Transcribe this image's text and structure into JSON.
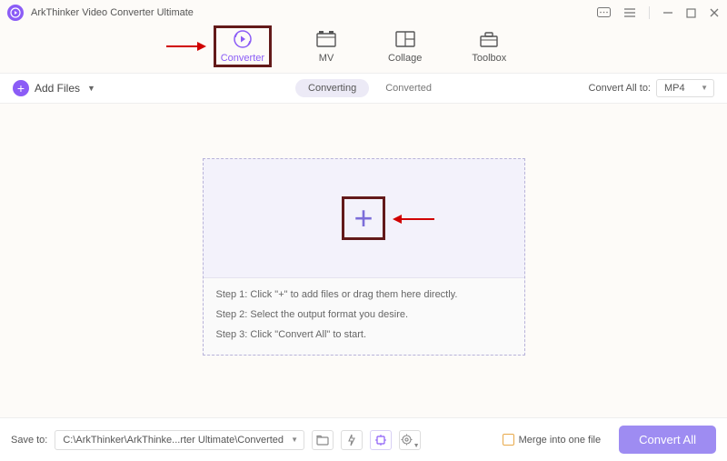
{
  "titlebar": {
    "title": "ArkThinker Video Converter Ultimate"
  },
  "tabs": {
    "converter": "Converter",
    "mv": "MV",
    "collage": "Collage",
    "toolbox": "Toolbox"
  },
  "toolbar": {
    "add_files": "Add Files",
    "converting": "Converting",
    "converted": "Converted",
    "convert_all_to": "Convert All to:",
    "format": "MP4"
  },
  "dropzone": {
    "step1": "Step 1: Click \"+\" to add files or drag them here directly.",
    "step2": "Step 2: Select the output format you desire.",
    "step3": "Step 3: Click \"Convert All\" to start."
  },
  "bottom": {
    "save_to": "Save to:",
    "path": "C:\\ArkThinker\\ArkThinke...rter Ultimate\\Converted",
    "merge": "Merge into one file",
    "convert_all": "Convert All"
  }
}
